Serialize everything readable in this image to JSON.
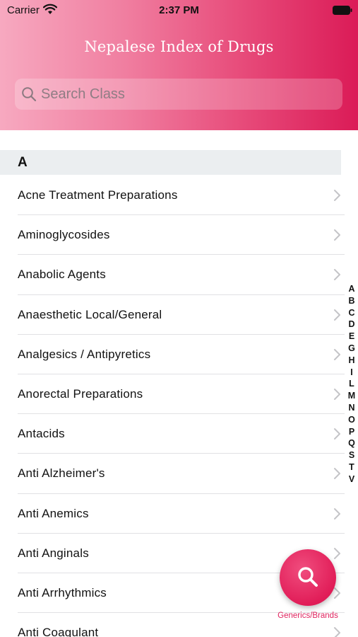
{
  "status_bar": {
    "carrier": "Carrier",
    "time": "2:37 PM"
  },
  "header": {
    "title": "Nepalese Index of Drugs",
    "search_placeholder": "Search Class",
    "gradient": [
      "#f7a9c0",
      "#db1b57"
    ]
  },
  "section": {
    "letter": "A"
  },
  "items": [
    {
      "label": "Acne Treatment Preparations"
    },
    {
      "label": "Aminoglycosides"
    },
    {
      "label": "Anabolic Agents"
    },
    {
      "label": "Anaesthetic Local/General"
    },
    {
      "label": "Analgesics / Antipyretics"
    },
    {
      "label": "Anorectal Preparations"
    },
    {
      "label": "Antacids"
    },
    {
      "label": "Anti Alzheimer's"
    },
    {
      "label": "Anti Anemics"
    },
    {
      "label": "Anti Anginals"
    },
    {
      "label": "Anti Arrhythmics"
    },
    {
      "label": "Anti Coagulant"
    }
  ],
  "index_letters": [
    "A",
    "B",
    "C",
    "D",
    "E",
    "G",
    "H",
    "I",
    "L",
    "M",
    "N",
    "O",
    "P",
    "Q",
    "S",
    "T",
    "V"
  ],
  "fab": {
    "label": "Generics/Brands",
    "icon": "search-icon",
    "color": "#e11d58"
  }
}
